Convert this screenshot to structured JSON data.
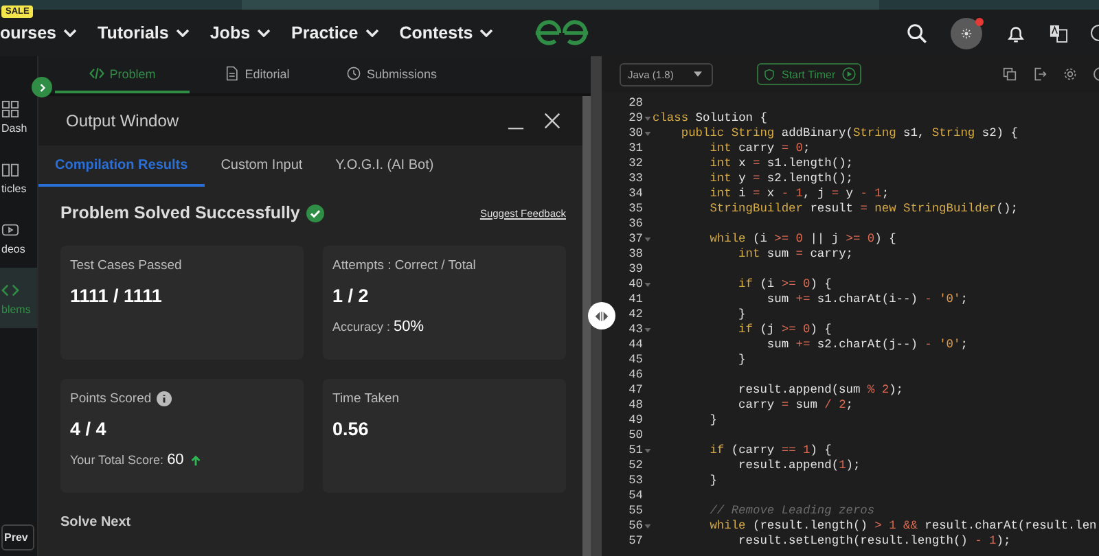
{
  "nav": {
    "sale_badge": "SALE",
    "items": [
      {
        "label": "ourses"
      },
      {
        "label": "Tutorials"
      },
      {
        "label": "Jobs"
      },
      {
        "label": "Practice"
      },
      {
        "label": "Contests"
      }
    ],
    "notification_dot": true
  },
  "sidebar": {
    "items": [
      {
        "label": "Dash",
        "selected": false
      },
      {
        "label": "ticles",
        "selected": false
      },
      {
        "label": "deos",
        "selected": false
      },
      {
        "label": "blems",
        "selected": true
      }
    ],
    "prev_button": "Prev"
  },
  "problem_tabs": [
    {
      "label": "Problem",
      "selected": true
    },
    {
      "label": "Editorial",
      "selected": false
    },
    {
      "label": "Submissions",
      "selected": false
    }
  ],
  "output_window": {
    "title": "Output Window",
    "tabs": [
      {
        "label": "Compilation Results",
        "selected": true
      },
      {
        "label": "Custom Input",
        "selected": false
      },
      {
        "label": "Y.O.G.I. (AI Bot)",
        "selected": false
      }
    ],
    "status": "Problem Solved Successfully",
    "solved": true,
    "feedback_link": "Suggest Feedback",
    "cards": [
      {
        "label": "Test Cases Passed",
        "info": false,
        "value": "1111 / 1111"
      },
      {
        "label": "Attempts : Correct / Total",
        "info": false,
        "value": "1 / 2",
        "note_label": "Accuracy :",
        "note_value": "50%"
      },
      {
        "label": "Points Scored",
        "info": true,
        "value": "4 / 4",
        "note_label": "Your Total Score:",
        "note_value": "60",
        "trend_up": true
      },
      {
        "label": "Time Taken",
        "info": false,
        "value": "0.56"
      }
    ],
    "solve_next": "Solve Next"
  },
  "editor": {
    "language": "Java (1.8)",
    "timer_button": "Start Timer",
    "lines": [
      {
        "number": "28",
        "fold": false
      },
      {
        "number": "29",
        "fold": true,
        "tokens": [
          {
            "kind": "keyword",
            "text": "class"
          },
          {
            "kind": "plain",
            "text": " Solution {"
          }
        ]
      },
      {
        "number": "30",
        "fold": true,
        "tokens": [
          {
            "kind": "keyword",
            "text": "    public String"
          },
          {
            "kind": "plain",
            "text": " addBinary("
          },
          {
            "kind": "keyword",
            "text": "String"
          },
          {
            "kind": "plain",
            "text": " s1, "
          },
          {
            "kind": "keyword",
            "text": "String"
          },
          {
            "kind": "plain",
            "text": " s2) {"
          }
        ]
      },
      {
        "number": "31",
        "fold": false,
        "tokens": [
          {
            "kind": "keyword",
            "text": "        int"
          },
          {
            "kind": "plain",
            "text": " carry "
          },
          {
            "kind": "operator",
            "text": "= "
          },
          {
            "kind": "number",
            "text": "0"
          },
          {
            "kind": "plain",
            "text": ";"
          }
        ]
      },
      {
        "number": "32",
        "fold": false,
        "tokens": [
          {
            "kind": "keyword",
            "text": "        int"
          },
          {
            "kind": "plain",
            "text": " x "
          },
          {
            "kind": "operator",
            "text": "="
          },
          {
            "kind": "plain",
            "text": " s1.length();"
          }
        ]
      },
      {
        "number": "33",
        "fold": false,
        "tokens": [
          {
            "kind": "keyword",
            "text": "        int"
          },
          {
            "kind": "plain",
            "text": " y "
          },
          {
            "kind": "operator",
            "text": "="
          },
          {
            "kind": "plain",
            "text": " s2.length();"
          }
        ]
      },
      {
        "number": "34",
        "fold": false,
        "tokens": [
          {
            "kind": "keyword",
            "text": "        int"
          },
          {
            "kind": "plain",
            "text": " i "
          },
          {
            "kind": "operator",
            "text": "="
          },
          {
            "kind": "plain",
            "text": " x "
          },
          {
            "kind": "operator",
            "text": "- "
          },
          {
            "kind": "number",
            "text": "1"
          },
          {
            "kind": "plain",
            "text": ", j "
          },
          {
            "kind": "operator",
            "text": "="
          },
          {
            "kind": "plain",
            "text": " y "
          },
          {
            "kind": "operator",
            "text": "- "
          },
          {
            "kind": "number",
            "text": "1"
          },
          {
            "kind": "plain",
            "text": ";"
          }
        ]
      },
      {
        "number": "35",
        "fold": false,
        "tokens": [
          {
            "kind": "keyword",
            "text": "        StringBuilder"
          },
          {
            "kind": "plain",
            "text": " result "
          },
          {
            "kind": "operator",
            "text": "= "
          },
          {
            "kind": "keyword",
            "text": "new StringBuilder"
          },
          {
            "kind": "plain",
            "text": "();"
          }
        ]
      },
      {
        "number": "36",
        "fold": false
      },
      {
        "number": "37",
        "fold": true,
        "tokens": [
          {
            "kind": "keyword",
            "text": "        while"
          },
          {
            "kind": "plain",
            "text": " (i "
          },
          {
            "kind": "operator",
            "text": ">= "
          },
          {
            "kind": "number",
            "text": "0"
          },
          {
            "kind": "plain",
            "text": " || j "
          },
          {
            "kind": "operator",
            "text": ">= "
          },
          {
            "kind": "number",
            "text": "0"
          },
          {
            "kind": "plain",
            "text": ") {"
          }
        ]
      },
      {
        "number": "38",
        "fold": false,
        "tokens": [
          {
            "kind": "keyword",
            "text": "            int"
          },
          {
            "kind": "plain",
            "text": " sum "
          },
          {
            "kind": "operator",
            "text": "="
          },
          {
            "kind": "plain",
            "text": " carry;"
          }
        ]
      },
      {
        "number": "39",
        "fold": false
      },
      {
        "number": "40",
        "fold": true,
        "tokens": [
          {
            "kind": "keyword",
            "text": "            if"
          },
          {
            "kind": "plain",
            "text": " (i "
          },
          {
            "kind": "operator",
            "text": ">= "
          },
          {
            "kind": "number",
            "text": "0"
          },
          {
            "kind": "plain",
            "text": ") {"
          }
        ]
      },
      {
        "number": "41",
        "fold": false,
        "tokens": [
          {
            "kind": "plain",
            "text": "                sum "
          },
          {
            "kind": "operator",
            "text": "+="
          },
          {
            "kind": "plain",
            "text": " s1.charAt(i--) "
          },
          {
            "kind": "operator",
            "text": "- "
          },
          {
            "kind": "string",
            "text": "'0'"
          },
          {
            "kind": "plain",
            "text": ";"
          }
        ]
      },
      {
        "number": "42",
        "fold": false,
        "tokens": [
          {
            "kind": "plain",
            "text": "            }"
          }
        ]
      },
      {
        "number": "43",
        "fold": true,
        "tokens": [
          {
            "kind": "keyword",
            "text": "            if"
          },
          {
            "kind": "plain",
            "text": " (j "
          },
          {
            "kind": "operator",
            "text": ">= "
          },
          {
            "kind": "number",
            "text": "0"
          },
          {
            "kind": "plain",
            "text": ") {"
          }
        ]
      },
      {
        "number": "44",
        "fold": false,
        "tokens": [
          {
            "kind": "plain",
            "text": "                sum "
          },
          {
            "kind": "operator",
            "text": "+="
          },
          {
            "kind": "plain",
            "text": " s2.charAt(j--) "
          },
          {
            "kind": "operator",
            "text": "- "
          },
          {
            "kind": "string",
            "text": "'0'"
          },
          {
            "kind": "plain",
            "text": ";"
          }
        ]
      },
      {
        "number": "45",
        "fold": false,
        "tokens": [
          {
            "kind": "plain",
            "text": "            }"
          }
        ]
      },
      {
        "number": "46",
        "fold": false
      },
      {
        "number": "47",
        "fold": false,
        "tokens": [
          {
            "kind": "plain",
            "text": "            result.append(sum "
          },
          {
            "kind": "operator",
            "text": "% "
          },
          {
            "kind": "number",
            "text": "2"
          },
          {
            "kind": "plain",
            "text": ");"
          }
        ]
      },
      {
        "number": "48",
        "fold": false,
        "tokens": [
          {
            "kind": "plain",
            "text": "            carry "
          },
          {
            "kind": "operator",
            "text": "="
          },
          {
            "kind": "plain",
            "text": " sum "
          },
          {
            "kind": "operator",
            "text": "/ "
          },
          {
            "kind": "number",
            "text": "2"
          },
          {
            "kind": "plain",
            "text": ";"
          }
        ]
      },
      {
        "number": "49",
        "fold": false,
        "tokens": [
          {
            "kind": "plain",
            "text": "        }"
          }
        ]
      },
      {
        "number": "50",
        "fold": false
      },
      {
        "number": "51",
        "fold": true,
        "tokens": [
          {
            "kind": "keyword",
            "text": "        if"
          },
          {
            "kind": "plain",
            "text": " (carry "
          },
          {
            "kind": "operator",
            "text": "== "
          },
          {
            "kind": "number",
            "text": "1"
          },
          {
            "kind": "plain",
            "text": ") {"
          }
        ]
      },
      {
        "number": "52",
        "fold": false,
        "tokens": [
          {
            "kind": "plain",
            "text": "            result.append("
          },
          {
            "kind": "number",
            "text": "1"
          },
          {
            "kind": "plain",
            "text": ");"
          }
        ]
      },
      {
        "number": "53",
        "fold": false,
        "tokens": [
          {
            "kind": "plain",
            "text": "        }"
          }
        ]
      },
      {
        "number": "54",
        "fold": false
      },
      {
        "number": "55",
        "fold": false,
        "tokens": [
          {
            "kind": "comment",
            "text": "        // Remove Leading zeros"
          }
        ]
      },
      {
        "number": "56",
        "fold": true,
        "tokens": [
          {
            "kind": "keyword",
            "text": "        while"
          },
          {
            "kind": "plain",
            "text": " (result.length() "
          },
          {
            "kind": "operator",
            "text": "> "
          },
          {
            "kind": "number",
            "text": "1 "
          },
          {
            "kind": "operator",
            "text": "&&"
          },
          {
            "kind": "plain",
            "text": " result.charAt(result.len"
          }
        ]
      },
      {
        "number": "57",
        "fold": false,
        "tokens": [
          {
            "kind": "plain",
            "text": "            result.setLength(result.length() "
          },
          {
            "kind": "operator",
            "text": "- "
          },
          {
            "kind": "number",
            "text": "1"
          },
          {
            "kind": "plain",
            "text": ");"
          }
        ]
      }
    ]
  }
}
